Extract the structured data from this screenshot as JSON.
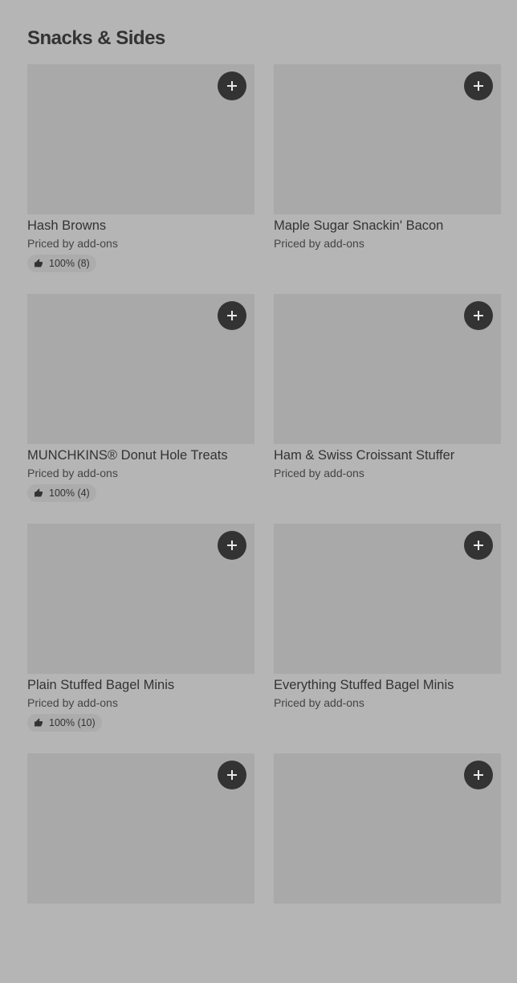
{
  "section": {
    "title": "Snacks & Sides"
  },
  "items": [
    {
      "name": "Hash Browns",
      "price": "Priced by add-ons",
      "rating": "100% (8)",
      "icon": "thumbs-up-icon"
    },
    {
      "name": "Maple Sugar Snackin' Bacon",
      "price": "Priced by add-ons",
      "rating": null
    },
    {
      "name": "MUNCHKINS® Donut Hole Treats",
      "price": "Priced by add-ons",
      "rating": "100% (4)",
      "icon": "thumbs-up-icon"
    },
    {
      "name": "Ham & Swiss Croissant Stuffer",
      "price": "Priced by add-ons",
      "rating": null
    },
    {
      "name": "Plain Stuffed Bagel Minis",
      "price": "Priced by add-ons",
      "rating": "100% (10)",
      "icon": "thumbs-up-icon"
    },
    {
      "name": "Everything Stuffed Bagel Minis",
      "price": "Priced by add-ons",
      "rating": null
    },
    {
      "name": null,
      "price": null,
      "rating": null
    },
    {
      "name": null,
      "price": null,
      "rating": null
    }
  ],
  "colors": {
    "background": "#b5b5b5",
    "image_placeholder": "#a9a9a9",
    "add_button": "#333333"
  },
  "icons": {
    "add": "plus-icon",
    "rating": "thumbs-up-icon"
  }
}
